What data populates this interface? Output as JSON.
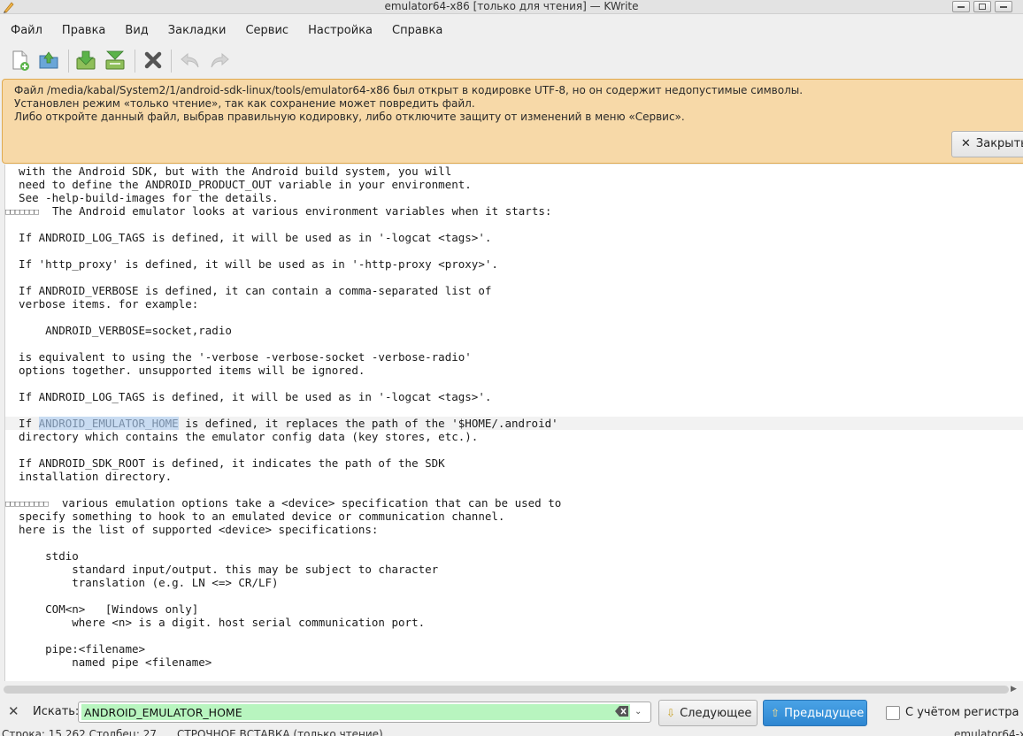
{
  "window": {
    "title": "emulator64-x86 [только для чтения] — KWrite"
  },
  "menu": [
    "Файл",
    "Правка",
    "Вид",
    "Закладки",
    "Сервис",
    "Настройка",
    "Справка"
  ],
  "toolbar": {
    "icons": [
      "new-document-icon",
      "open-document-icon",
      "save-icon",
      "save-as-icon",
      "close-document-icon",
      "undo-icon",
      "redo-icon"
    ]
  },
  "notice": {
    "lines": [
      "Файл /media/kabal/System2/1/android-sdk-linux/tools/emulator64-x86 был открыт в кодировке UTF-8, но он содержит недопустимые символы.",
      "Установлен режим «только чтение», так как сохранение может повредить файл.",
      "Либо откройте данный файл, выбрав правильную кодировку, либо отключите защиту от изменений в меню «Сервис»."
    ],
    "close_label": "Закрыть"
  },
  "editor": {
    "l0": "  with the Android SDK, but with the Android build system, you will",
    "l1": "  need to define the ANDROID_PRODUCT_OUT variable in your environment.",
    "l2": "  See -help-build-images for the details.",
    "l3_boxes": "□□□□□□□",
    "l3_text": "  The Android emulator looks at various environment variables when it starts:",
    "l5": "  If ANDROID_LOG_TAGS is defined, it will be used as in '-logcat <tags>'.",
    "l7": "  If 'http_proxy' is defined, it will be used as in '-http-proxy <proxy>'.",
    "l9": "  If ANDROID_VERBOSE is defined, it can contain a comma-separated list of",
    "l10": "  verbose items. for example:",
    "l12": "      ANDROID_VERBOSE=socket,radio",
    "l14": "  is equivalent to using the '-verbose -verbose-socket -verbose-radio'",
    "l15": "  options together. unsupported items will be ignored.",
    "l17": "  If ANDROID_LOG_TAGS is defined, it will be used as in '-logcat <tags>'.",
    "l19_pre": "  If ",
    "l19_hl": "ANDROID_EMULATOR_HOME",
    "l19_post": " is defined, it replaces the path of the '$HOME/.android'",
    "l20": "  directory which contains the emulator config data (key stores, etc.).",
    "l22": "  If ANDROID_SDK_ROOT is defined, it indicates the path of the SDK",
    "l23": "  installation directory.",
    "l25_boxes": "□□□□□□□□□",
    "l25_text": "  various emulation options take a <device> specification that can be used to",
    "l26": "  specify something to hook to an emulated device or communication channel.",
    "l27": "  here is the list of supported <device> specifications:",
    "l29": "      stdio",
    "l30": "          standard input/output. this may be subject to character",
    "l31": "          translation (e.g. LN <=> CR/LF)",
    "l33": "      COM<n>   [Windows only]",
    "l34": "          where <n> is a digit. host serial communication port.",
    "l36": "      pipe:<filename>",
    "l37": "          named pipe <filename>"
  },
  "findbar": {
    "label": "Искать:",
    "query": "ANDROID_EMULATOR_HOME",
    "next_label": "Следующее",
    "prev_label": "Предыдущее",
    "case_label": "С учётом регистра"
  },
  "statusbar": {
    "position": "Строка: 15 262 Столбец: 27",
    "mode": "СТРОЧНОЕ  ВСТАВКА (только чтение)",
    "file": "emulator64-x"
  },
  "colors": {
    "notice_bg": "#f7d9a8",
    "find_match_bg": "#b8f5bf",
    "selection": "#c9dcf2",
    "primary_button": "#2e86d1"
  }
}
